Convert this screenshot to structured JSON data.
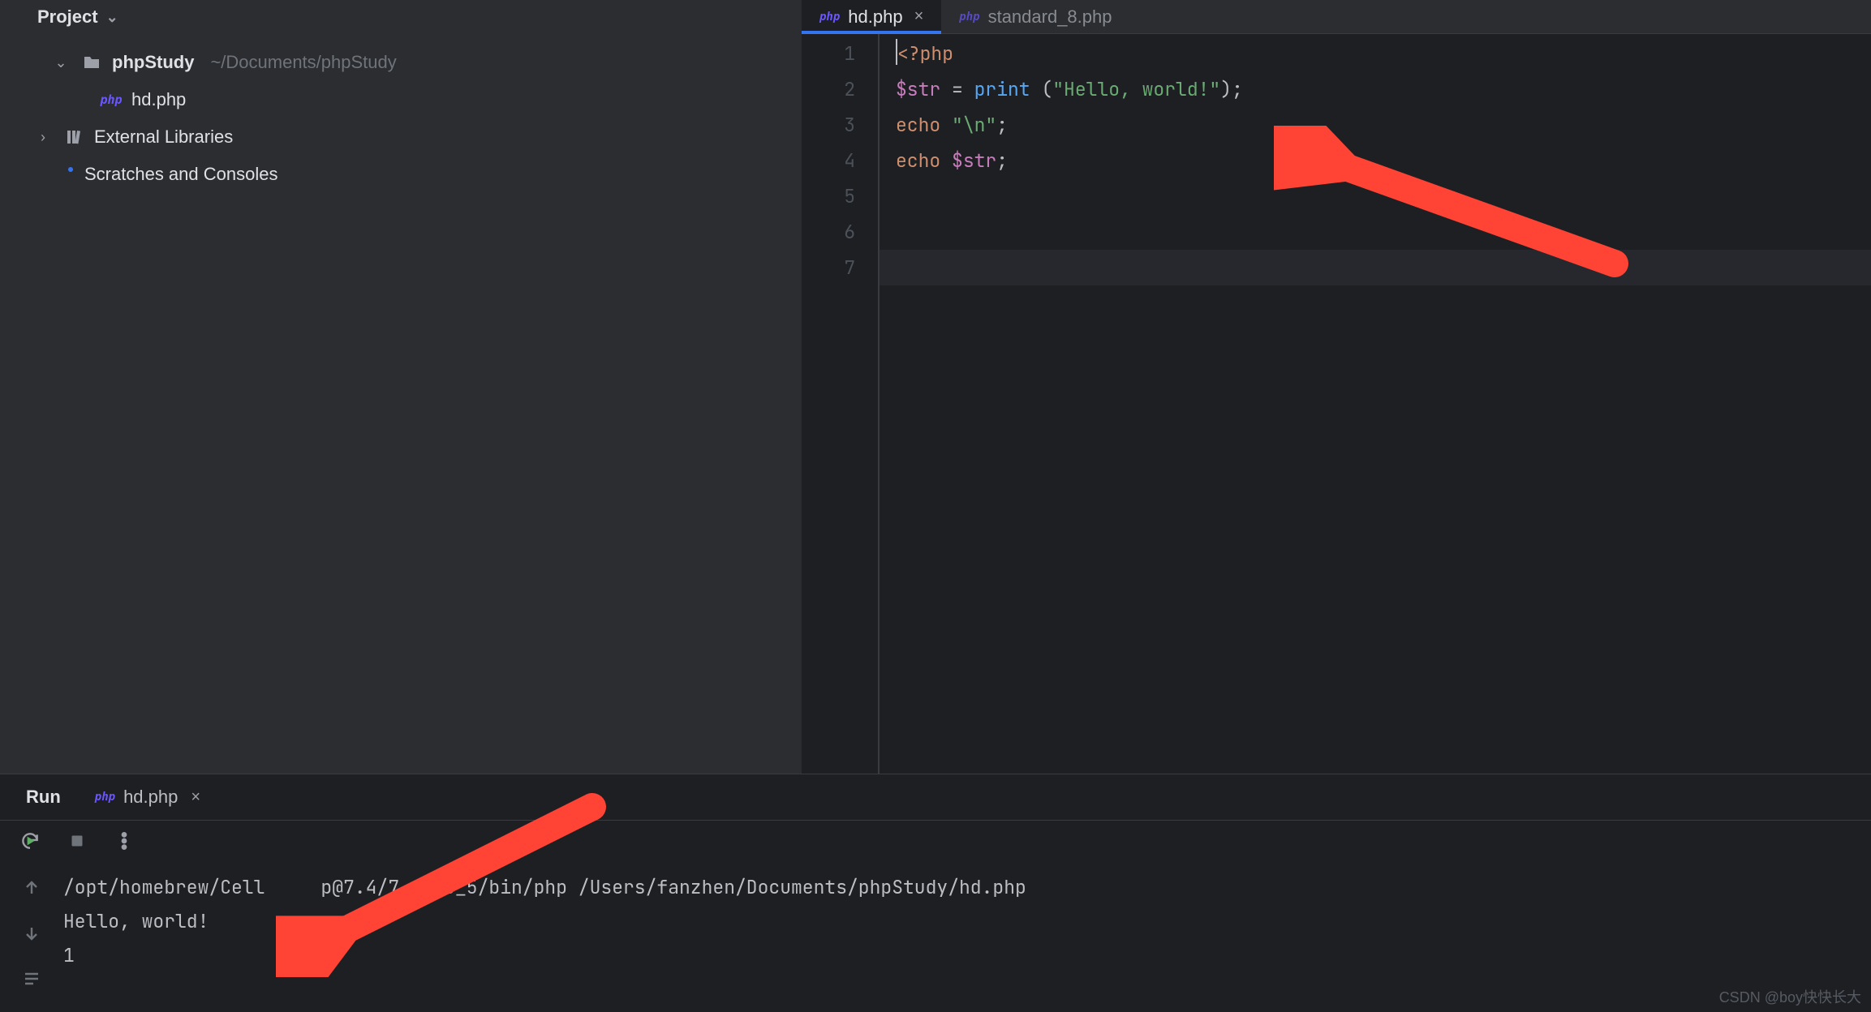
{
  "project_panel": {
    "title": "Project",
    "root": {
      "name": "phpStudy",
      "path": "~/Documents/phpStudy"
    },
    "file": {
      "name": "hd.php"
    },
    "external": "External Libraries",
    "scratches": "Scratches and Consoles"
  },
  "tabs": [
    {
      "name": "hd.php",
      "active": true,
      "closable": true
    },
    {
      "name": "standard_8.php",
      "active": false,
      "closable": false
    }
  ],
  "code": {
    "line_numbers": [
      "1",
      "2",
      "3",
      "4",
      "5",
      "6",
      "7"
    ],
    "l1_tag": "<?php",
    "l2_var": "$str",
    "l2_eq": " = ",
    "l2_fn": "print ",
    "l2_open": "(",
    "l2_str": "\"Hello, world!\"",
    "l2_close": ")",
    "l2_semi": ";",
    "l3_kw": "echo ",
    "l3_str": "\"\\n\"",
    "l3_semi": ";",
    "l4_kw": "echo ",
    "l4_var": "$str",
    "l4_semi": ";"
  },
  "run": {
    "label": "Run",
    "tab_name": "hd.php",
    "console": [
      "/opt/homebrew/Cell     p@7.4/7.4.33_5/bin/php /Users/fanzhen/Documents/phpStudy/hd.php",
      "Hello, world!",
      "1"
    ]
  },
  "watermark": "CSDN @boy快快长大"
}
